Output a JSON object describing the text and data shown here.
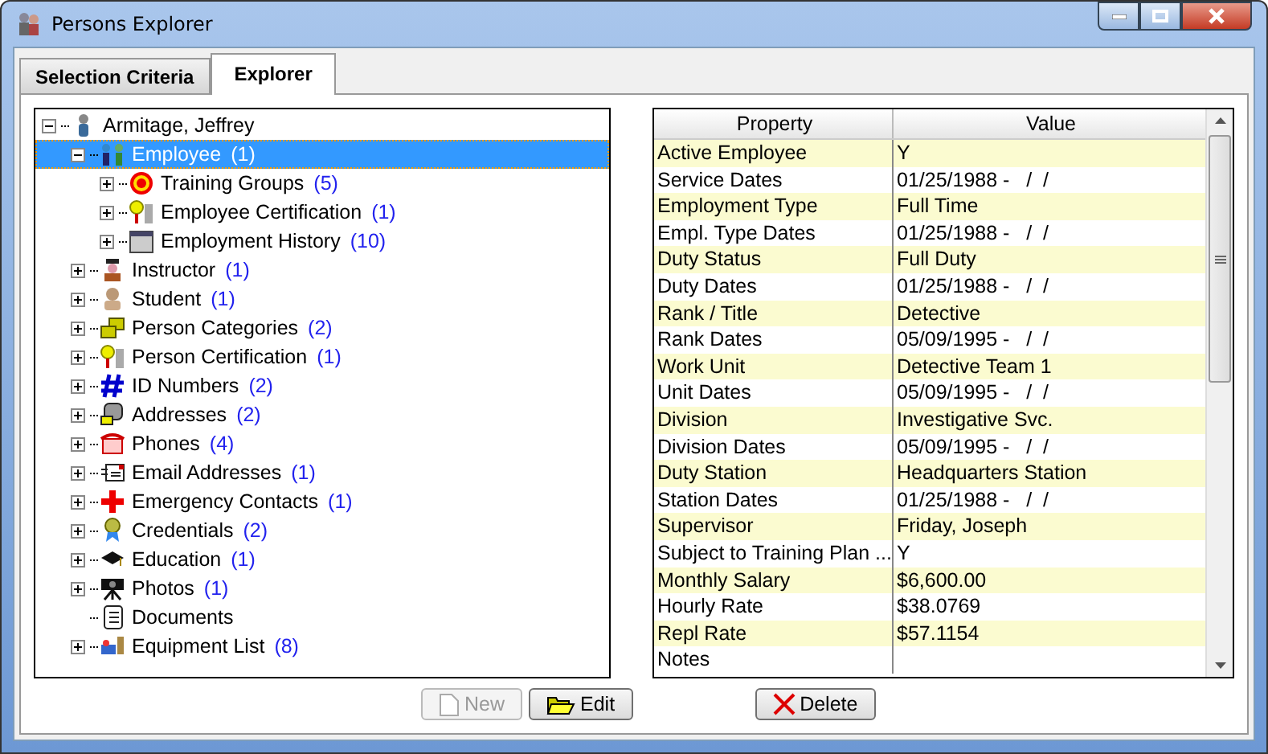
{
  "window": {
    "title": "Persons Explorer"
  },
  "tabs": [
    {
      "label": "Selection Criteria",
      "selected": false
    },
    {
      "label": "Explorer",
      "selected": true
    }
  ],
  "tree": [
    {
      "label": "Armitage, Jeffrey",
      "expandable": true,
      "expanded": true,
      "selected": false,
      "children": [
        {
          "label": "Employee",
          "count": "(1)",
          "expandable": true,
          "expanded": true,
          "selected": true,
          "children": [
            {
              "label": "Training Groups",
              "count": "(5)",
              "expandable": true,
              "expanded": false,
              "selected": false
            },
            {
              "label": "Employee Certification",
              "count": "(1)",
              "expandable": true,
              "expanded": false,
              "selected": false
            },
            {
              "label": "Employment History",
              "count": "(10)",
              "expandable": true,
              "expanded": false,
              "selected": false
            }
          ]
        },
        {
          "label": "Instructor",
          "count": "(1)",
          "expandable": true,
          "expanded": false,
          "selected": false
        },
        {
          "label": "Student",
          "count": "(1)",
          "expandable": true,
          "expanded": false,
          "selected": false
        },
        {
          "label": "Person Categories",
          "count": "(2)",
          "expandable": true,
          "expanded": false,
          "selected": false
        },
        {
          "label": "Person Certification",
          "count": "(1)",
          "expandable": true,
          "expanded": false,
          "selected": false
        },
        {
          "label": "ID Numbers",
          "count": "(2)",
          "expandable": true,
          "expanded": false,
          "selected": false
        },
        {
          "label": "Addresses",
          "count": "(2)",
          "expandable": true,
          "expanded": false,
          "selected": false
        },
        {
          "label": "Phones",
          "count": "(4)",
          "expandable": true,
          "expanded": false,
          "selected": false
        },
        {
          "label": "Email Addresses",
          "count": "(1)",
          "expandable": true,
          "expanded": false,
          "selected": false
        },
        {
          "label": "Emergency Contacts",
          "count": "(1)",
          "expandable": true,
          "expanded": false,
          "selected": false
        },
        {
          "label": "Credentials",
          "count": "(2)",
          "expandable": true,
          "expanded": false,
          "selected": false
        },
        {
          "label": "Education",
          "count": "(1)",
          "expandable": true,
          "expanded": false,
          "selected": false
        },
        {
          "label": "Photos",
          "count": "(1)",
          "expandable": true,
          "expanded": false,
          "selected": false
        },
        {
          "label": "Documents",
          "expandable": false,
          "expanded": false,
          "selected": false
        },
        {
          "label": "Equipment List",
          "count": "(8)",
          "expandable": true,
          "expanded": false,
          "selected": false
        }
      ]
    }
  ],
  "grid": {
    "columns": [
      "Property",
      "Value"
    ],
    "rows": [
      {
        "property": "Active Employee",
        "value": "Y"
      },
      {
        "property": "Service Dates",
        "value": "01/25/1988 -   /  /"
      },
      {
        "property": "Employment Type",
        "value": "Full Time"
      },
      {
        "property": "Empl. Type Dates",
        "value": "01/25/1988 -   /  /"
      },
      {
        "property": "Duty Status",
        "value": "Full Duty"
      },
      {
        "property": "Duty Dates",
        "value": "01/25/1988 -   /  /"
      },
      {
        "property": "Rank / Title",
        "value": "Detective"
      },
      {
        "property": "Rank Dates",
        "value": "05/09/1995 -   /  /"
      },
      {
        "property": "Work Unit",
        "value": "Detective Team 1"
      },
      {
        "property": "Unit Dates",
        "value": "05/09/1995 -   /  /"
      },
      {
        "property": "Division",
        "value": "Investigative Svc."
      },
      {
        "property": "Division Dates",
        "value": "05/09/1995 -   /  /"
      },
      {
        "property": "Duty Station",
        "value": "Headquarters Station"
      },
      {
        "property": "Station Dates",
        "value": "01/25/1988 -   /  /"
      },
      {
        "property": "Supervisor",
        "value": "Friday, Joseph"
      },
      {
        "property": "Subject to Training Plan  ...",
        "value": "Y"
      },
      {
        "property": "Monthly Salary",
        "value": "$6,600.00"
      },
      {
        "property": "Hourly Rate",
        "value": "$38.0769"
      },
      {
        "property": "Repl Rate",
        "value": "$57.1154"
      },
      {
        "property": "Notes"
      }
    ]
  },
  "buttons": [
    {
      "label": "New",
      "disabled": true
    },
    {
      "label": "Edit",
      "disabled": false
    },
    {
      "label": "Delete",
      "disabled": false
    }
  ]
}
